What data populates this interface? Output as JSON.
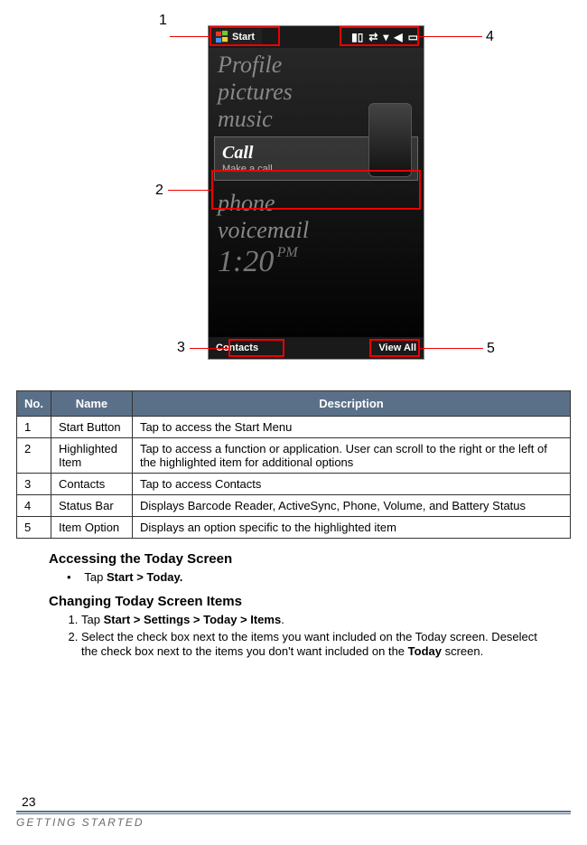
{
  "callouts": {
    "c1": "1",
    "c2": "2",
    "c3": "3",
    "c4": "4",
    "c5": "5"
  },
  "phone": {
    "start_label": "Start",
    "menu": {
      "m0": "Profile",
      "m1": "pictures",
      "m2": "music",
      "m3": "phone",
      "m4": "voicemail"
    },
    "call": {
      "title": "Call",
      "subtitle": "Make a call"
    },
    "clock": {
      "time": "1:20",
      "ampm": "PM"
    },
    "bottom_left": "Contacts",
    "bottom_right": "View All"
  },
  "table": {
    "headers": {
      "no": "No.",
      "name": "Name",
      "desc": "Description"
    },
    "rows": [
      {
        "no": "1",
        "name": "Start Button",
        "desc": "Tap to access the Start Menu"
      },
      {
        "no": "2",
        "name": "Highlighted Item",
        "desc": "Tap to access a function or application. User can scroll to the right or the left of the highlighted item for additional options"
      },
      {
        "no": "3",
        "name": "Contacts",
        "desc": "Tap to access Contacts"
      },
      {
        "no": "4",
        "name": "Status Bar",
        "desc": "Displays Barcode Reader, ActiveSync, Phone, Volume, and Battery Status"
      },
      {
        "no": "5",
        "name": "Item Option",
        "desc": "Displays an option specific to the highlighted item"
      }
    ]
  },
  "sections": {
    "accessing_title": "Accessing the Today Screen",
    "accessing_step_prefix": "Tap ",
    "accessing_step_bold": "Start > Today.",
    "changing_title": "Changing Today Screen Items",
    "changing_step1_prefix": "Tap ",
    "changing_step1_bold": "Start > Settings > Today > Items",
    "changing_step1_suffix": ".",
    "changing_step2_a": "Select the check box next to the items you want included on the Today screen. Deselect the check box next to the items you don't want included on the ",
    "changing_step2_bold": "Today",
    "changing_step2_b": " screen."
  },
  "footer": {
    "page": "23",
    "chapter": "Getting Started"
  }
}
